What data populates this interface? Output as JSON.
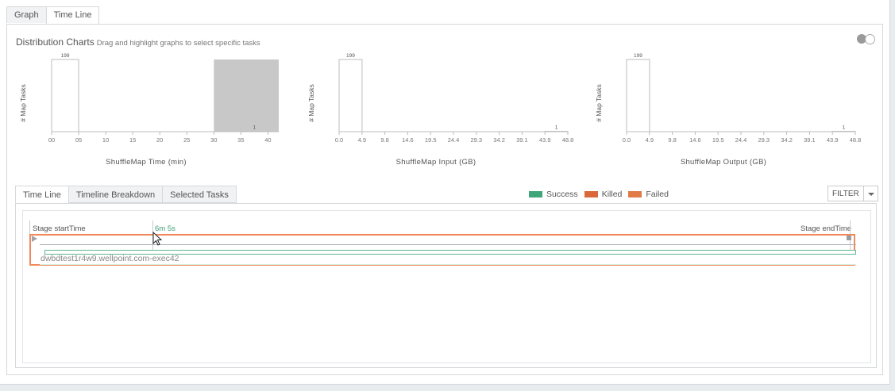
{
  "top_tabs": [
    {
      "label": "Graph",
      "active": false
    },
    {
      "label": "Time Line",
      "active": true
    }
  ],
  "distribution": {
    "title": "Distribution Charts",
    "subtitle": "Drag and highlight graphs to select specific tasks"
  },
  "chart_data": [
    {
      "type": "bar",
      "ylabel": "# Map Tasks",
      "xlabel": "ShuffleMap Time (min)",
      "tick_labels": [
        "00",
        "05",
        "10",
        "15",
        "20",
        "25",
        "30",
        "35",
        "40"
      ],
      "bins": [
        {
          "from": 0,
          "to": 5,
          "value": 199,
          "label": "199"
        },
        {
          "from": 35,
          "to": 40,
          "value": 1,
          "label": "1"
        }
      ],
      "highlight_range": [
        30,
        42
      ],
      "xlim": [
        0,
        42
      ]
    },
    {
      "type": "bar",
      "ylabel": "# Map Tasks",
      "xlabel": "ShuffleMap Input (GB)",
      "tick_labels": [
        "0.0",
        "4.9",
        "9.8",
        "14.6",
        "19.5",
        "24.4",
        "29.3",
        "34.2",
        "39.1",
        "43.9",
        "48.8"
      ],
      "bins": [
        {
          "from": 0,
          "to": 4.9,
          "value": 199,
          "label": "199"
        },
        {
          "from": 43.9,
          "to": 48.8,
          "value": 1,
          "label": "1"
        }
      ],
      "xlim": [
        0,
        48.8
      ]
    },
    {
      "type": "bar",
      "ylabel": "# Map Tasks",
      "xlabel": "ShuffleMap Output (GB)",
      "tick_labels": [
        "0.0",
        "4.9",
        "9.8",
        "14.6",
        "19.5",
        "24.4",
        "29.3",
        "34.2",
        "39.1",
        "43.9",
        "48.8"
      ],
      "bins": [
        {
          "from": 0,
          "to": 4.9,
          "value": 199,
          "label": "199"
        },
        {
          "from": 43.9,
          "to": 48.8,
          "value": 1,
          "label": "1"
        }
      ],
      "xlim": [
        0,
        48.8
      ]
    }
  ],
  "sub_tabs": [
    {
      "label": "Time Line",
      "active": true
    },
    {
      "label": "Timeline Breakdown",
      "active": false
    },
    {
      "label": "Selected Tasks",
      "active": false
    }
  ],
  "legend": [
    {
      "label": "Success",
      "color": "#3fa57a"
    },
    {
      "label": "Killed",
      "color": "#d9693a"
    },
    {
      "label": "Failed",
      "color": "#e07a46"
    }
  ],
  "filter_label": "FILTER",
  "timeline": {
    "start_label": "Stage startTime",
    "duration_label": "6m 5s",
    "end_label": "Stage endTime",
    "host_label": "dwbdtest1r4w9.wellpoint.com-exec42"
  }
}
